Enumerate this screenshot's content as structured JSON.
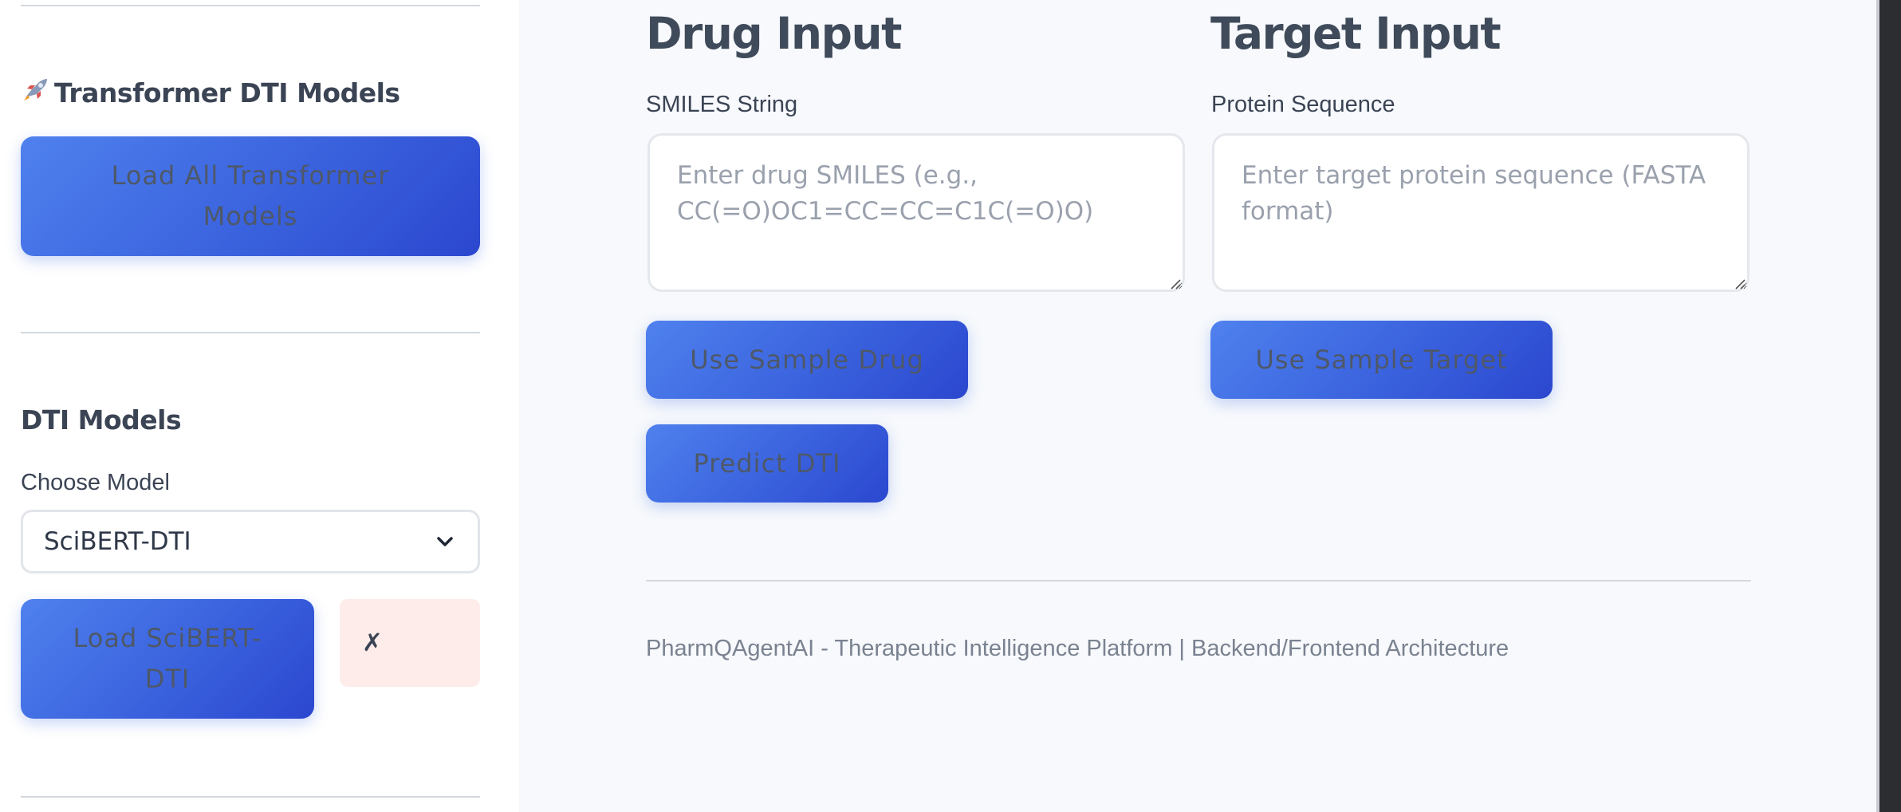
{
  "sidebar": {
    "transformer_section": {
      "icon": "rocket-icon",
      "title": "Transformer DTI Models",
      "load_all_button": "Load All Transformer Models"
    },
    "dti_section": {
      "title": "DTI Models",
      "choose_model_label": "Choose Model",
      "selected_model": "SciBERT-DTI",
      "load_button": "Load SciBERT-DTI",
      "status_symbol": "✗"
    }
  },
  "drug_input": {
    "title": "Drug Input",
    "field_label": "SMILES String",
    "placeholder": "Enter drug SMILES (e.g., CC(=O)OC1=CC=CC=C1C(=O)O)",
    "sample_button": "Use Sample Drug"
  },
  "target_input": {
    "title": "Target Input",
    "field_label": "Protein Sequence",
    "placeholder": "Enter target protein sequence (FASTA format)",
    "sample_button": "Use Sample Target"
  },
  "predict_button": "Predict DTI",
  "footer": "PharmQAgentAI - Therapeutic Intelligence Platform | Backend/Frontend Architecture",
  "colors": {
    "button_gradient_start": "#4f81ee",
    "button_gradient_end": "#2b47cf",
    "error_badge_bg": "#fdecea",
    "page_bg": "#f7f9fc"
  }
}
